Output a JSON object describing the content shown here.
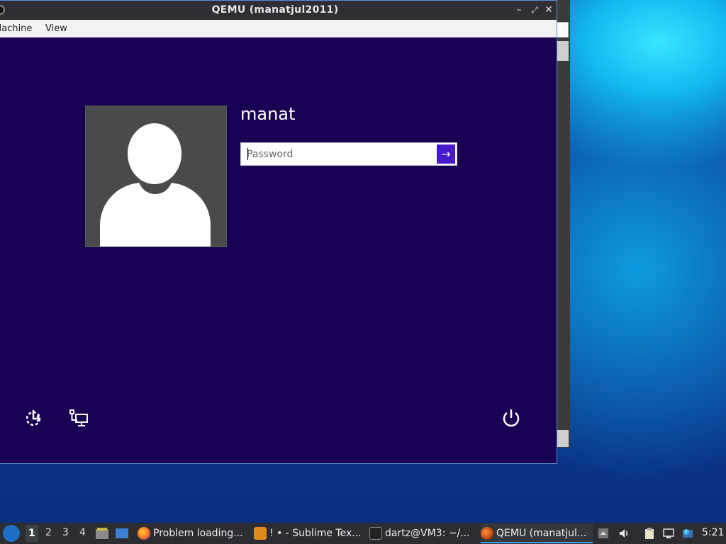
{
  "window": {
    "title": "QEMU (manatjul2011)",
    "menu": [
      "Machine",
      "View"
    ]
  },
  "login": {
    "username": "manat",
    "password_placeholder": "Password",
    "submit_glyph": "→"
  },
  "taskbar": {
    "workspaces": [
      "1",
      "2",
      "3",
      "4"
    ],
    "active_workspace": "1",
    "tasks": [
      {
        "label": "Problem loading...",
        "icon": "firefox-icon"
      },
      {
        "label": "! • - Sublime Tex...",
        "icon": "sublime-icon"
      },
      {
        "label": "dartz@VM3: ~/...",
        "icon": "terminal-icon"
      },
      {
        "label": "QEMU (manatjul...",
        "icon": "qemu-icon"
      }
    ],
    "clock": "5:21"
  },
  "colors": {
    "guest_bg": "#180052",
    "accent": "#4619c9",
    "avatar_bg": "#4a4a4a",
    "taskbar_bg": "#2b2d30"
  }
}
